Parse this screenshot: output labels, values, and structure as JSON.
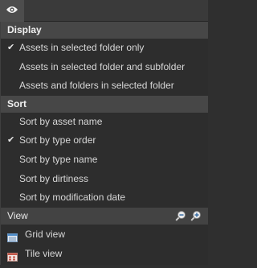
{
  "toolbar": {
    "view_options_icon": "eye-icon"
  },
  "display": {
    "header": "Display",
    "items": [
      {
        "label": "Assets in selected folder only",
        "checked": true
      },
      {
        "label": "Assets in selected folder and subfolder",
        "checked": false
      },
      {
        "label": "Assets and folders in selected folder",
        "checked": false
      }
    ]
  },
  "sort": {
    "header": "Sort",
    "items": [
      {
        "label": "Sort by asset name",
        "checked": false
      },
      {
        "label": "Sort by type order",
        "checked": true
      },
      {
        "label": "Sort by type name",
        "checked": false
      },
      {
        "label": "Sort by dirtiness",
        "checked": false
      },
      {
        "label": "Sort by modification date",
        "checked": false
      }
    ]
  },
  "view": {
    "header": "View",
    "zoom_out_icon": "zoom-out-icon",
    "zoom_in_icon": "zoom-in-icon",
    "items": [
      {
        "label": "Grid view",
        "icon": "grid-view-icon"
      },
      {
        "label": "Tile view",
        "icon": "tile-view-icon"
      }
    ]
  },
  "colors": {
    "header_bg": "#474747",
    "panel_bg": "#2d2d2d",
    "accent_blue": "#5a9bd8"
  }
}
